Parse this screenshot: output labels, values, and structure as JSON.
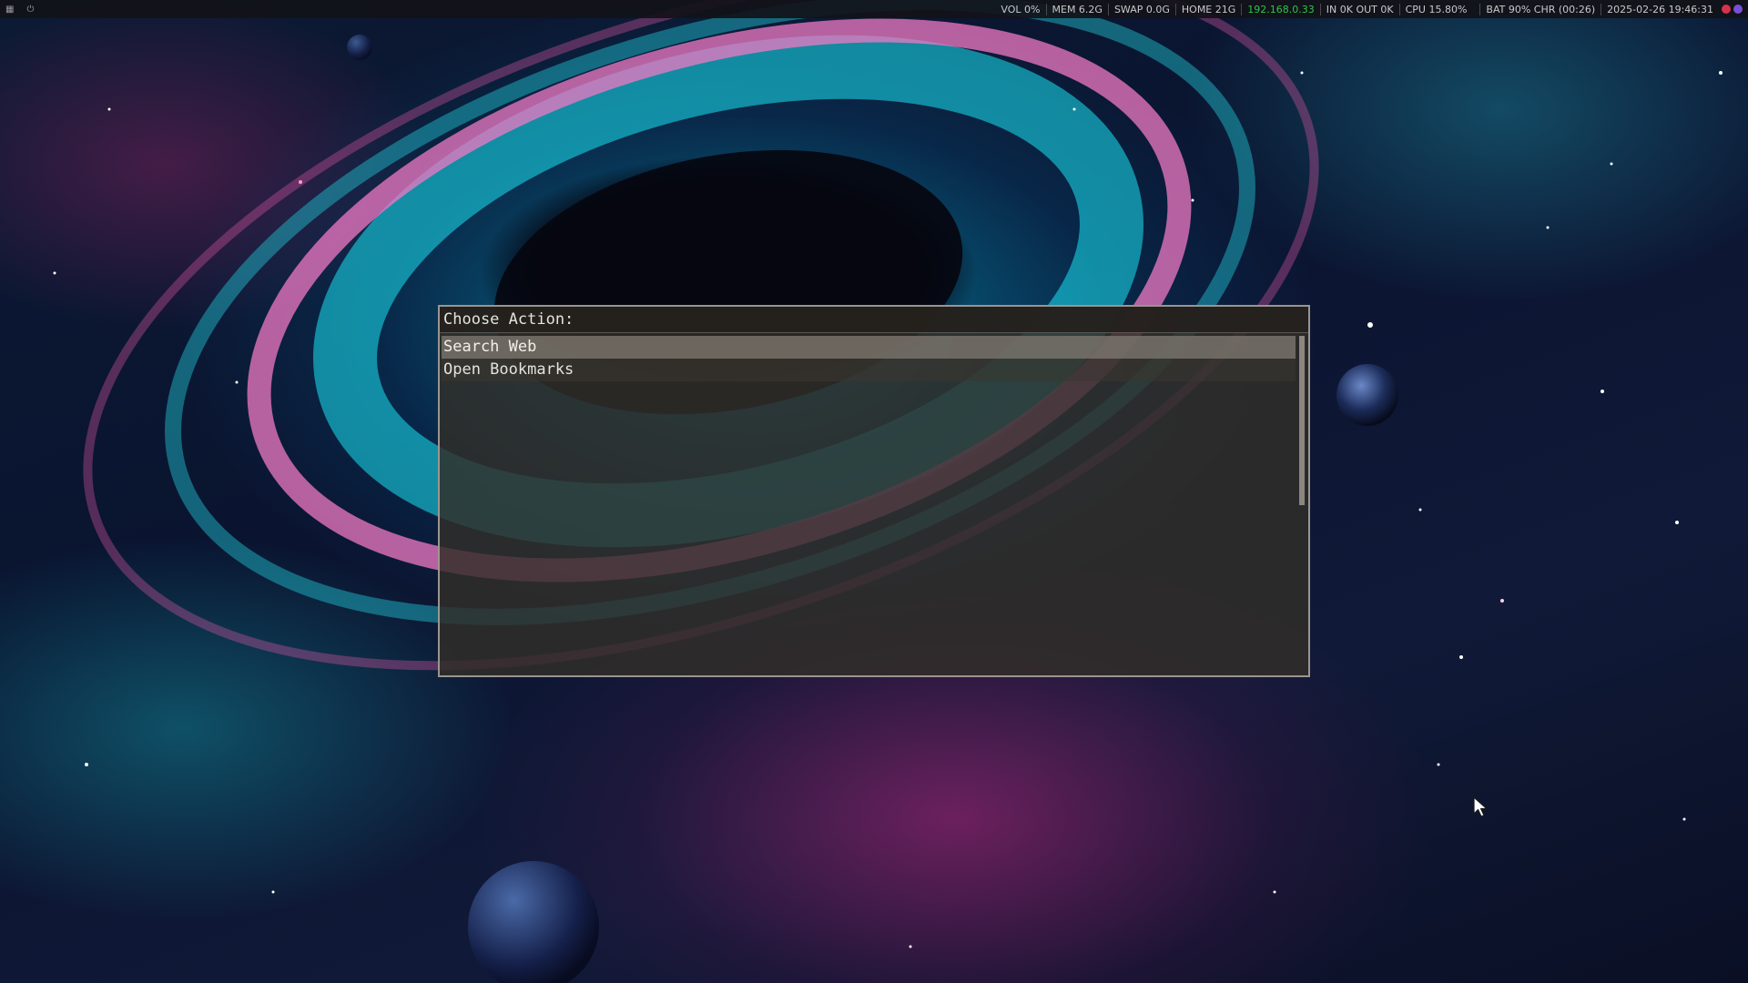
{
  "topbar": {
    "left_icons": [
      "window-icon",
      "power-icon"
    ],
    "status": [
      {
        "name": "volume",
        "text": "VOL 0%"
      },
      {
        "name": "memory",
        "text": "MEM 6.2G"
      },
      {
        "name": "swap",
        "text": "SWAP 0.0G"
      },
      {
        "name": "home-disk",
        "text": "HOME 21G"
      },
      {
        "name": "ip-address",
        "text": "192.168.0.33"
      },
      {
        "name": "network",
        "text": "IN 0K OUT 0K"
      },
      {
        "name": "cpu",
        "text": "CPU 15.80%"
      },
      {
        "name": "battery",
        "text": "BAT 90% CHR (00:26)"
      },
      {
        "name": "datetime",
        "text": "2025-02-26 19:46:31"
      }
    ],
    "colors": {
      "ip_address": "#2ec44a",
      "tray_1": "#d6324e",
      "tray_2": "#7a4fd8"
    }
  },
  "prompt": {
    "title": "Choose Action:",
    "options": [
      {
        "label": "Search Web",
        "selected": true
      },
      {
        "label": "Open Bookmarks",
        "selected": false
      }
    ]
  }
}
